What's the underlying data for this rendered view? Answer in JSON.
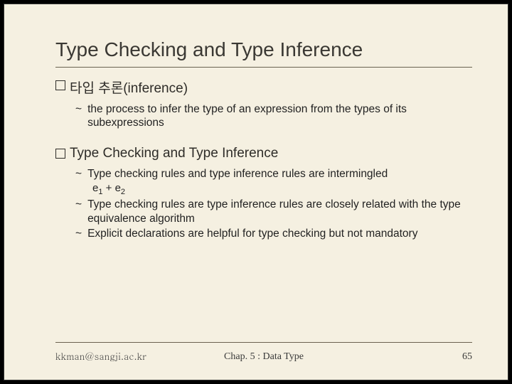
{
  "title": "Type Checking and Type Inference",
  "sections": [
    {
      "heading": "타입 추론(inference)",
      "items": [
        {
          "text": "the process to infer the type of an expression from the types of its subexpressions"
        }
      ],
      "expr": null
    },
    {
      "heading": "Type Checking and Type Inference",
      "items": [
        {
          "text": "Type checking rules and type inference rules are intermingled"
        }
      ],
      "expr": {
        "e1": "e",
        "s1": "1",
        "plus": " + e",
        "s2": "2"
      },
      "items2": [
        {
          "text": "Type checking rules are type inference rules are closely related with the type equivalence algorithm"
        },
        {
          "text": "Explicit declarations are helpful for type checking but not mandatory"
        }
      ]
    }
  ],
  "footer": {
    "email": "kkman@sangji.ac.kr",
    "center": "Chap. 5 : Data Type",
    "page": "65"
  }
}
